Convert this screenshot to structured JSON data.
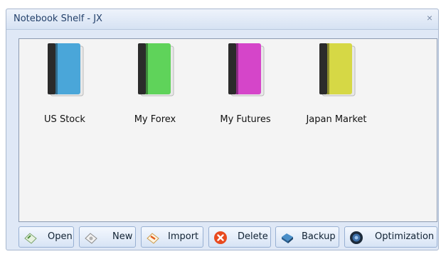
{
  "window": {
    "title": "Notebook Shelf - JX",
    "close_glyph": "×"
  },
  "shelf": {
    "notebooks": [
      {
        "label": "US Stock",
        "color": "#4aa6d9",
        "icon": "book-icon"
      },
      {
        "label": "My Forex",
        "color": "#5fd35a",
        "icon": "book-icon"
      },
      {
        "label": "My Futures",
        "color": "#d545c9",
        "icon": "book-icon"
      },
      {
        "label": "Japan Market",
        "color": "#d6d845",
        "icon": "book-icon"
      }
    ]
  },
  "toolbar": {
    "open_label": "Open",
    "new_label": "New",
    "import_label": "Import",
    "delete_label": "Delete",
    "backup_label": "Backup",
    "optimization_label": "Optimization"
  }
}
